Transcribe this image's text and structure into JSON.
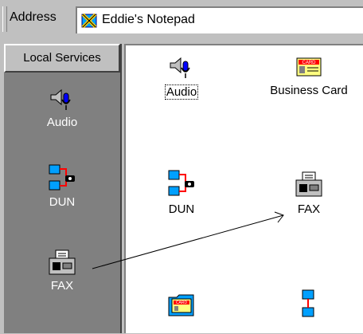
{
  "address_bar": {
    "label": "Address",
    "value": "Eddie's Notepad",
    "icon": "notepad-x-icon"
  },
  "left_pane": {
    "header": "Local Services",
    "items": [
      {
        "label": "Audio",
        "icon": "audio-speaker-microphone-icon"
      },
      {
        "label": "DUN",
        "icon": "dial-up-networking-icon"
      },
      {
        "label": "FAX",
        "icon": "fax-machine-icon"
      }
    ]
  },
  "main_pane": {
    "items": [
      {
        "label": "Audio",
        "icon": "audio-speaker-microphone-icon",
        "focused": true
      },
      {
        "label": "Business Card",
        "icon": "business-card-icon"
      },
      {
        "label": "DUN",
        "icon": "dial-up-networking-icon"
      },
      {
        "label": "FAX",
        "icon": "fax-machine-icon"
      },
      {
        "label": "",
        "icon": "card-folder-icon"
      },
      {
        "label": "",
        "icon": "network-computers-icon"
      }
    ]
  },
  "colors": {
    "chrome": "#c0c0c0",
    "left_pane_bg": "#808080",
    "main_pane_bg": "#ffffff"
  }
}
